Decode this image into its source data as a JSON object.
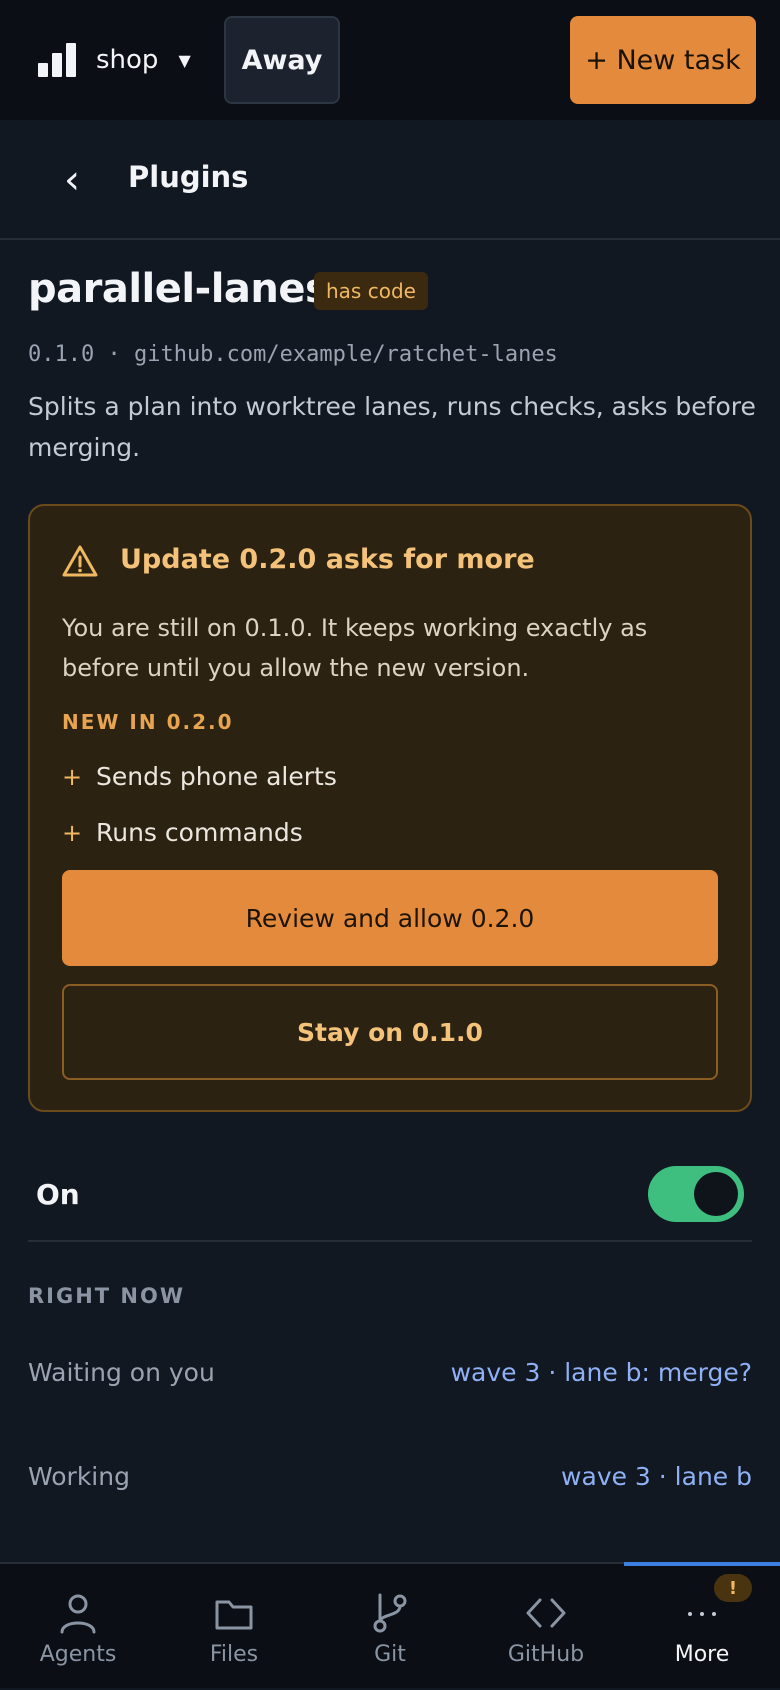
{
  "topbar": {
    "workspace_name": "shop",
    "workspace_caret": "▼",
    "away_label": "Away",
    "new_task_label": "+ New task"
  },
  "header": {
    "back_glyph": "‹",
    "title": "Plugins"
  },
  "plugin": {
    "name": "parallel-lanes",
    "badge": "has code",
    "meta": "0.1.0 · github.com/example/ratchet-lanes",
    "description": "Splits a plan into worktree lanes, runs checks, asks before merging."
  },
  "update": {
    "title": "Update 0.2.0 asks for more",
    "body": "You are still on 0.1.0. It keeps working exactly as before until you allow the new version.",
    "new_label": "NEW IN 0.2.0",
    "items": [
      {
        "glyph": "+",
        "label": "Sends phone alerts"
      },
      {
        "glyph": "+",
        "label": "Runs commands"
      }
    ],
    "review_label": "Review and allow 0.2.0",
    "stay_label": "Stay on 0.1.0"
  },
  "toggle": {
    "label": "On",
    "state": true
  },
  "right_now": {
    "label": "RIGHT NOW",
    "rows": [
      {
        "key": "Waiting on you",
        "value": "wave 3 · lane b: merge?"
      },
      {
        "key": "Working",
        "value": "wave 3 · lane b"
      }
    ]
  },
  "nav": {
    "items": [
      {
        "label": "Agents",
        "icon": "person-icon"
      },
      {
        "label": "Files",
        "icon": "folder-icon"
      },
      {
        "label": "Git",
        "icon": "git-branch-icon"
      },
      {
        "label": "GitHub",
        "icon": "code-brackets-icon"
      },
      {
        "label": "More",
        "icon": "ellipsis-icon"
      }
    ],
    "active": "More",
    "more_badge": "!"
  },
  "colors": {
    "accent": "#e38a3c",
    "warning": "#f5c27a",
    "toggle_on": "#3fbf7f",
    "link": "#8fb0f5"
  }
}
